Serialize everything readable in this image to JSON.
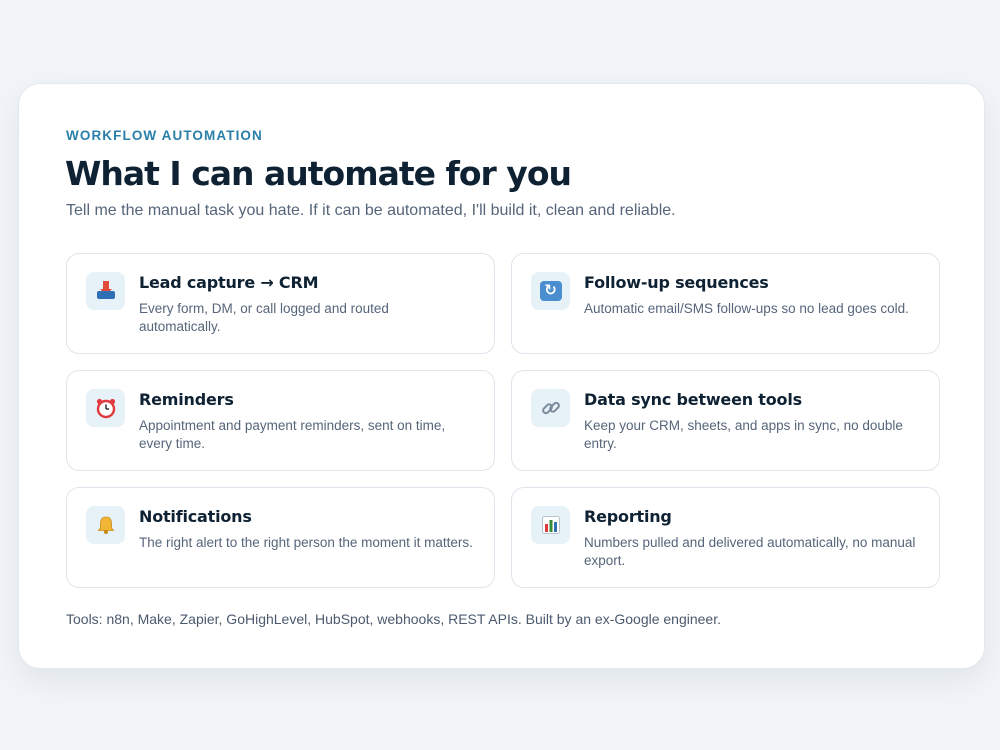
{
  "section": {
    "eyebrow": "WORKFLOW AUTOMATION",
    "title": "What I can automate for you",
    "subtitle": "Tell me the manual task you hate. If it can be automated, I'll build it, clean and reliable."
  },
  "features": [
    {
      "icon": "inbox-tray-icon",
      "title": "Lead capture → CRM",
      "description": "Every form, DM, or call logged and routed automatically."
    },
    {
      "icon": "repeat-icon",
      "title": "Follow-up sequences",
      "description": "Automatic email/SMS follow-ups so no lead goes cold."
    },
    {
      "icon": "alarm-clock-icon",
      "title": "Reminders",
      "description": "Appointment and payment reminders, sent on time, every time."
    },
    {
      "icon": "link-icon",
      "title": "Data sync between tools",
      "description": "Keep your CRM, sheets, and apps in sync, no double entry."
    },
    {
      "icon": "bell-icon",
      "title": "Notifications",
      "description": "The right alert to the right person the moment it matters."
    },
    {
      "icon": "bar-chart-icon",
      "title": "Reporting",
      "description": "Numbers pulled and delivered automatically, no manual export."
    }
  ],
  "footer": "Tools: n8n, Make, Zapier, GoHighLevel, HubSpot, webhooks, REST APIs. Built by an ex-Google engineer.",
  "colors": {
    "accent": "#2a7fa8",
    "heading": "#0f2233",
    "body": "#56657a",
    "icon_bg": "#e6f1f8",
    "page_bg": "#f1f4f8"
  }
}
